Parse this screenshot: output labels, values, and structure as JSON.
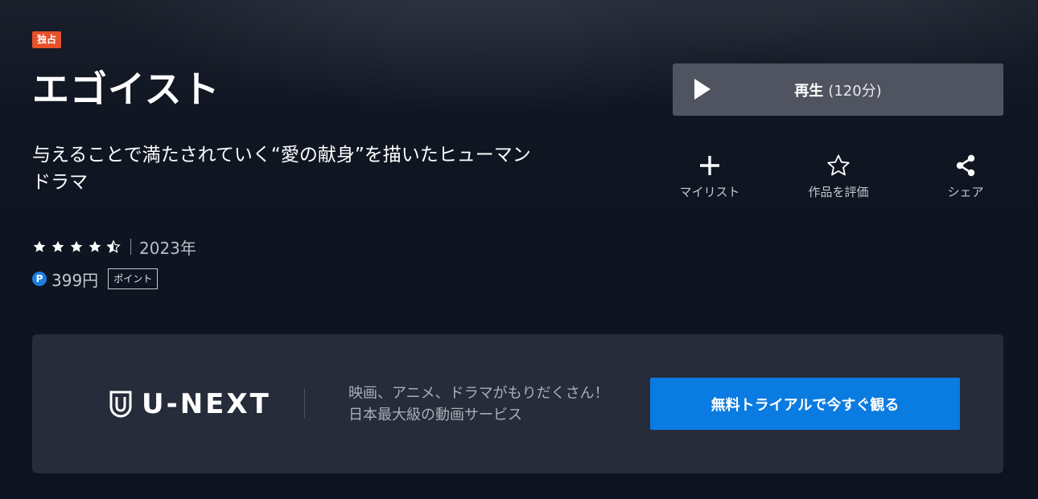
{
  "badge": "独占",
  "title": "エゴイスト",
  "catchcopy_line1": "与えることで満たされていく“愛の献身”を描いたヒューマン",
  "catchcopy_line2": "ドラマ",
  "rating": {
    "stars": 4.5,
    "max": 5
  },
  "year": "2023年",
  "price": {
    "points_icon": "P",
    "amount": "399円",
    "tag": "ポイント"
  },
  "play_button": {
    "label": "再生",
    "duration": "(120分)"
  },
  "actions": [
    {
      "label": "マイリスト",
      "icon": "plus-icon"
    },
    {
      "label": "作品を評価",
      "icon": "star-outline-icon"
    },
    {
      "label": "シェア",
      "icon": "share-icon"
    }
  ],
  "banner": {
    "logo_text": "U-NEXT",
    "promo_line1": "映画、アニメ、ドラマがもりだくさん！",
    "promo_line2": "日本最大級の動画サービス",
    "cta": "無料トライアルで今すぐ観る"
  },
  "colors": {
    "badge": "#e8502a",
    "cta": "#0a7be0",
    "play_button": "#4f5460",
    "banner": "#262c39"
  }
}
